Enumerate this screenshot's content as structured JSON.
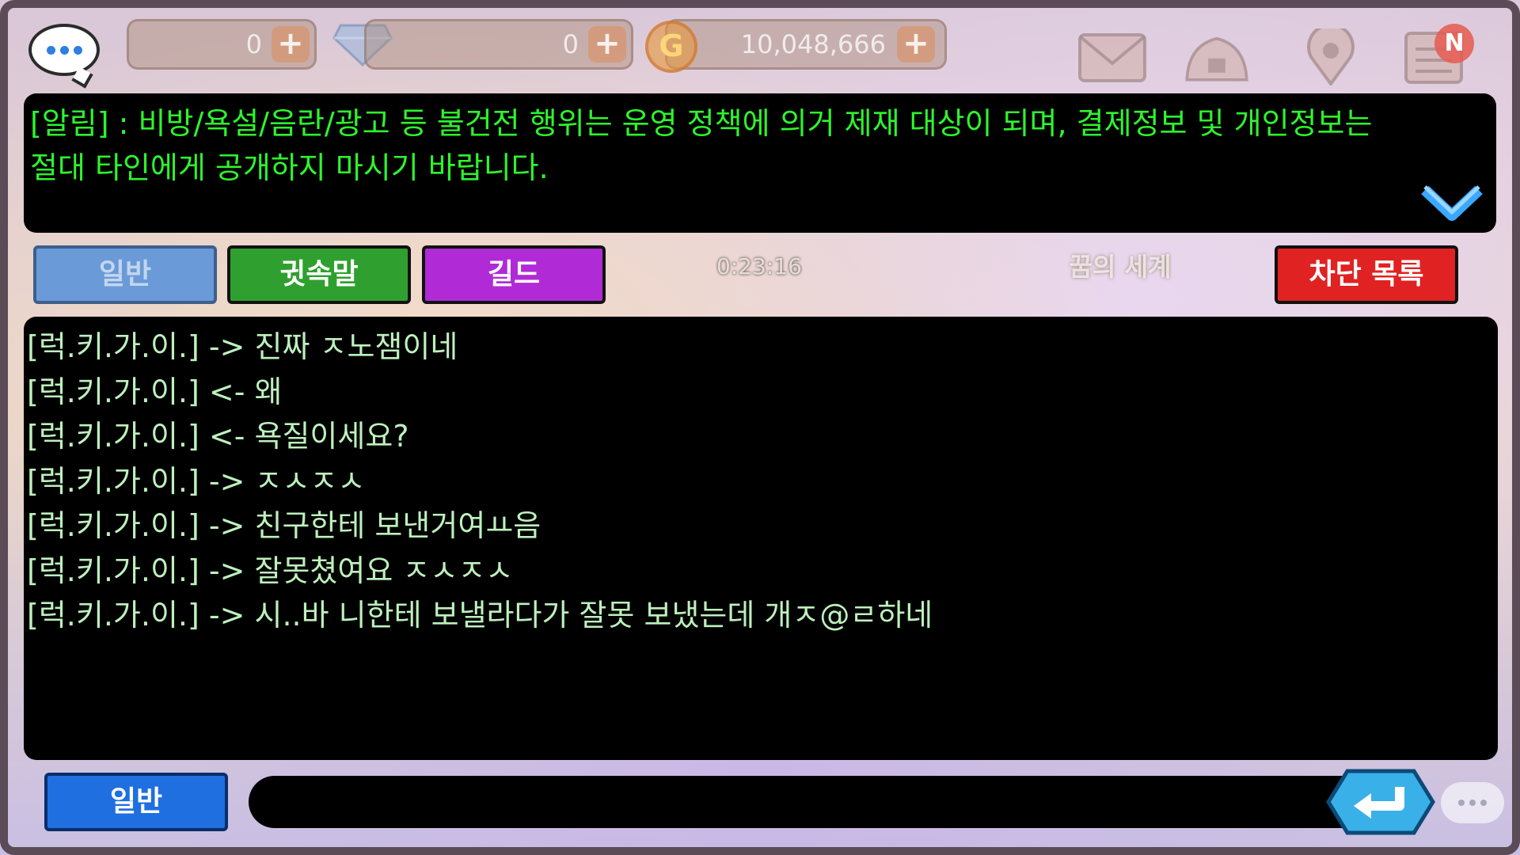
{
  "topbar": {
    "resource_1_value": "0",
    "resource_2_value": "0",
    "gold_value": "10,048,666",
    "gold_symbol": "G",
    "plus": "+",
    "new_badge": "N"
  },
  "notice": {
    "text_line1": "[알림] : 비방/욕설/음란/광고 등 불건전 행위는 운영 정책에 의거 제재 대상이 되며, 결제정보 및 개인정보는",
    "text_line2": "절대 타인에게 공개하지 마시기 바랍니다."
  },
  "tabs": {
    "general": "일반",
    "whisper": "귓속말",
    "guild": "길드",
    "block_list": "차단 목록"
  },
  "timer": "0:23:16",
  "world_name": "꿈의 세계",
  "chat_lines": [
    "[럭.키.가.이.] -> 진짜 ㅈ노잼이네",
    "[럭.키.가.이.] <- 왜",
    "[럭.키.가.이.] <- 욕질이세요?",
    "[럭.키.가.이.] -> ㅈㅅㅈㅅ",
    "[럭.키.가.이.] -> 친구한테 보낸거여ㅛ음",
    "[럭.키.가.이.] -> 잘못쳤여요 ㅈㅅㅈㅅ",
    "[럭.키.가.이.] -> 시..바 니한테 보낼라다가 잘못 보냈는데 개ㅈ@ㄹ하네"
  ],
  "input": {
    "channel_label": "일반",
    "value": "",
    "placeholder": ""
  },
  "icons": {
    "chat": "speech-bubble-icon",
    "gem": "diamond-icon",
    "gold": "gold-coin-icon",
    "mail": "mail-icon",
    "house": "house-icon",
    "location": "map-pin-icon",
    "quest": "quest-list-icon",
    "collapse": "chevron-down-icon",
    "send": "enter-arrow-icon"
  },
  "colors": {
    "notice_text": "#2df52d",
    "chat_text": "#bdf0bd",
    "tab_whisper": "#2fa02f",
    "tab_guild": "#b02bd6",
    "tab_block": "#e02222",
    "channel_button": "#1f6fe0"
  }
}
